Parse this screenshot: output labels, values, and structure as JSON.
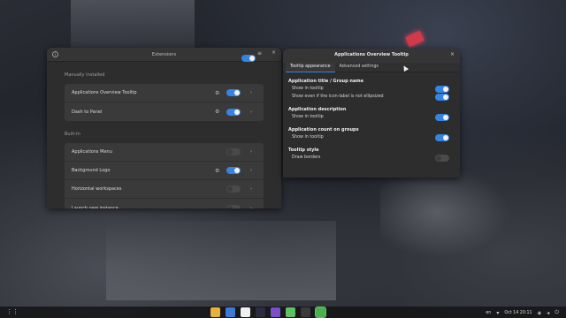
{
  "extensions_window": {
    "title": "Extensions",
    "master_switch_on": true,
    "sections": [
      {
        "title": "Manually Installed",
        "rows": [
          {
            "label": "Applications Overview Tooltip",
            "has_settings": true,
            "enabled": true
          },
          {
            "label": "Dash to Panel",
            "has_settings": true,
            "enabled": true
          }
        ]
      },
      {
        "title": "Built-In",
        "rows": [
          {
            "label": "Applications Menu",
            "has_settings": false,
            "enabled": false
          },
          {
            "label": "Background Logo",
            "has_settings": true,
            "enabled": true
          },
          {
            "label": "Horizontal workspaces",
            "has_settings": false,
            "enabled": false
          },
          {
            "label": "Launch new instance",
            "has_settings": false,
            "enabled": false
          }
        ]
      }
    ]
  },
  "prefs_window": {
    "title": "Applications Overview Tooltip",
    "close_glyph": "×",
    "tabs": [
      {
        "label": "Tooltip appearance",
        "active": true
      },
      {
        "label": "Advanced settings",
        "active": false
      }
    ],
    "groups": [
      {
        "title": "Application title / Group name",
        "options": [
          {
            "label": "Show in tooltip",
            "on": true
          },
          {
            "label": "Show even if the icon-label is not ellipsized",
            "on": true
          }
        ]
      },
      {
        "title": "Application description",
        "options": [
          {
            "label": "Show in tooltip",
            "on": true
          }
        ]
      },
      {
        "title": "Application count on groups",
        "options": [
          {
            "label": "Show in tooltip",
            "on": true
          }
        ]
      },
      {
        "title": "Tooltip style",
        "options": [
          {
            "label": "Draw borders",
            "on": false
          }
        ]
      }
    ]
  },
  "taskbar": {
    "dock_items": [
      {
        "name": "chrome-icon",
        "color": "#e8b23a"
      },
      {
        "name": "documents-icon",
        "color": "#3a7bd5"
      },
      {
        "name": "notes-icon",
        "color": "#f0f0f0"
      },
      {
        "name": "terminal-icon",
        "color": "#2b2b3b"
      },
      {
        "name": "text-editor-icon",
        "color": "#7a4fc9"
      },
      {
        "name": "extension-manager-icon",
        "color": "#5ec262"
      },
      {
        "name": "obs-icon",
        "color": "#3a3a3a"
      },
      {
        "name": "extensions-icon",
        "color": "#4caf50"
      }
    ],
    "active_item": 7,
    "language": "en",
    "clock": "Oct 14  20:11",
    "status_icons": [
      "network-icon",
      "volume-icon",
      "power-icon"
    ]
  }
}
